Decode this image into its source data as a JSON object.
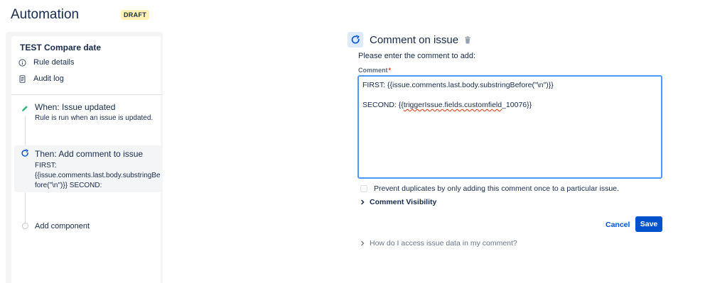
{
  "header": {
    "title": "Automation",
    "badge": "DRAFT"
  },
  "sidebar": {
    "rule_name": "TEST Compare date",
    "links": [
      {
        "label": "Rule details",
        "icon": "info-icon"
      },
      {
        "label": "Audit log",
        "icon": "document-icon"
      }
    ],
    "steps": [
      {
        "title": "When: Issue updated",
        "desc_lines": [
          "Rule is run when an issue is updated."
        ],
        "icon": "pencil-icon",
        "icon_color": "#36b37e",
        "active": false
      },
      {
        "title": "Then: Add comment to issue",
        "desc_lines": [
          "FIRST:",
          "{{issue.comments.last.body.substringBe",
          "fore(\"\\n\")}} SECOND:"
        ],
        "icon": "comment-icon",
        "icon_color": "#0052cc",
        "active": true
      }
    ],
    "add_component": "Add component"
  },
  "panel": {
    "title": "Comment on issue",
    "prompt": "Please enter the comment to add:",
    "comment_label": "Comment",
    "required_mark": "*",
    "comment_line1": "FIRST: {{issue.comments.last.body.substringBefore(\"\\n\")}}",
    "comment_line2_prefix": "SECOND: {{",
    "comment_line2_misspelled": "triggerIssue.fields.customfield",
    "comment_line2_suffix": "_10076}}",
    "prevent_duplicates": "Prevent duplicates by only adding this comment once to a particular issue.",
    "prevent_duplicates_checked": false,
    "comment_visibility": "Comment Visibility",
    "cancel": "Cancel",
    "save": "Save",
    "help": "How do I access issue data in my comment?"
  },
  "colors": {
    "primary": "#0052cc",
    "focus_border": "#4c9aff",
    "draft_bg": "#fff0b3",
    "required": "#de350b"
  }
}
